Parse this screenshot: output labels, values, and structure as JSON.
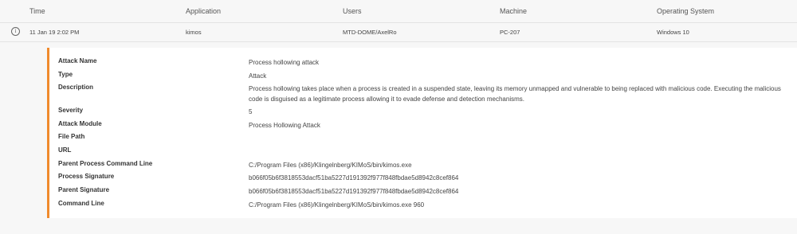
{
  "table": {
    "columns": [
      "Time",
      "Application",
      "Users",
      "Machine",
      "Operating System"
    ],
    "row": {
      "info_icon": "info-icon",
      "time": "11 Jan 19 2:02 PM",
      "application": "kimos",
      "users": "MTD-DOME/AxelRo",
      "machine": "PC-207",
      "os": "Windows 10"
    }
  },
  "details": [
    {
      "label": "Attack Name",
      "value": "Process hollowing attack"
    },
    {
      "label": "Type",
      "value": "Attack"
    },
    {
      "label": "Description",
      "value": "Process hollowing takes place when a process is created in a suspended state, leaving its memory unmapped and vulnerable to being replaced with malicious code. Executing the malicious code is disguised as a legitimate process allowing it to evade defense and detection mechanisms."
    },
    {
      "label": "Severity",
      "value": "5"
    },
    {
      "label": "Attack Module",
      "value": "Process Hollowing Attack"
    },
    {
      "label": "File Path",
      "value": ""
    },
    {
      "label": "URL",
      "value": ""
    },
    {
      "label": "Parent Process Command Line",
      "value": "C:/Program Files (x86)/Klingelnberg/KIMoS/bin/kimos.exe"
    },
    {
      "label": "Process Signature",
      "value": "b066f05b6f3818553dacf51ba5227d191392f977f848fbdae5d8942c8cef864"
    },
    {
      "label": "Parent Signature",
      "value": "b066f05b6f3818553dacf51ba5227d191392f977f848fbdae5d8942c8cef864"
    },
    {
      "label": "Command Line",
      "value": "C:/Program Files (x86)/Klingelnberg/KIMoS/bin/kimos.exe 960"
    }
  ],
  "colors": {
    "accent": "#f08a2c",
    "background": "#f7f7f7",
    "panel": "#ffffff"
  }
}
